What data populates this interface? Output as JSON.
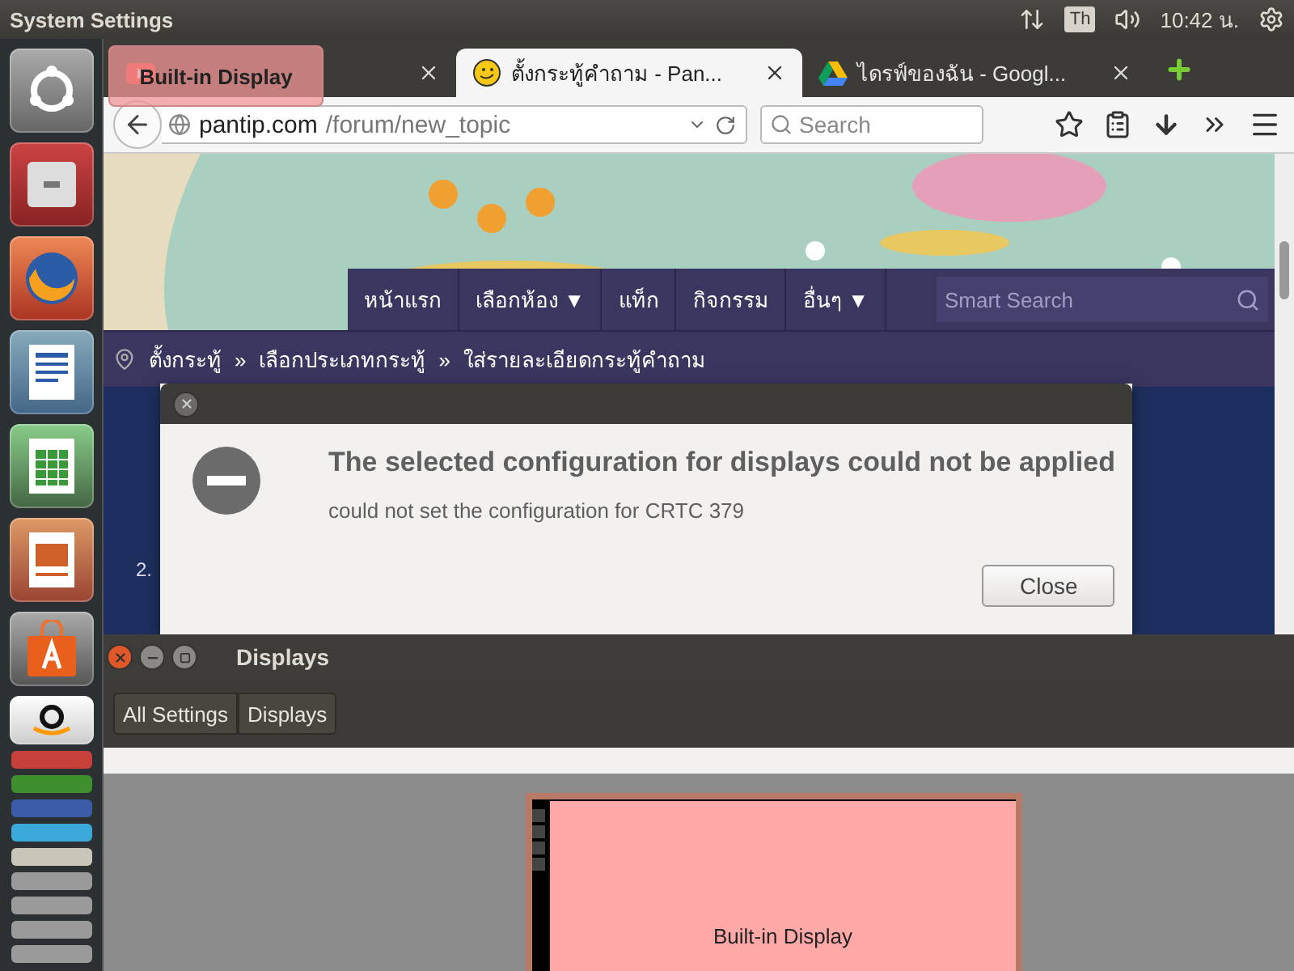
{
  "top_panel": {
    "title": "System Settings",
    "keyboard_layout": "Th",
    "clock": "10:42 น."
  },
  "launcher": {
    "items": [
      {
        "kind": "dash"
      },
      {
        "kind": "files"
      },
      {
        "kind": "firefox"
      },
      {
        "kind": "writer"
      },
      {
        "kind": "calc"
      },
      {
        "kind": "impress"
      },
      {
        "kind": "software"
      },
      {
        "kind": "amazon"
      },
      {
        "kind": "folded",
        "color": "#c8403a"
      },
      {
        "kind": "folded",
        "color": "#3f8f2f"
      },
      {
        "kind": "folded",
        "color": "#3b5da8"
      },
      {
        "kind": "folded",
        "color": "#3aa8d8"
      },
      {
        "kind": "folded",
        "color": "#c8c6b8"
      },
      {
        "kind": "folded",
        "color": "#9a9a9a"
      },
      {
        "kind": "folded",
        "color": "#9a9a9a"
      },
      {
        "kind": "folded",
        "color": "#9a9a9a"
      },
      {
        "kind": "folded",
        "color": "#9a9a9a"
      }
    ]
  },
  "browser": {
    "tabs": [
      {
        "kind": "video",
        "selected": false
      },
      {
        "kind": "emoji",
        "title": "ตั้งกระทู้คำถาม - Pan...",
        "selected": true
      },
      {
        "kind": "drive",
        "title": "ไดรฟ์ของฉัน - Googl...",
        "selected": false
      }
    ],
    "address": {
      "host": "pantip.com",
      "path": "/forum/new_topic"
    },
    "search": {
      "placeholder": "Search"
    },
    "page": {
      "nav": [
        "หน้าแรก",
        "เลือกห้อง ▼",
        "แท็ก",
        "กิจกรรม",
        "อื่นๆ ▼"
      ],
      "smart_search": {
        "placeholder": "Smart Search"
      },
      "breadcrumb": {
        "separator": "»",
        "items": [
          "ตั้งกระทู้",
          "เลือกประเภทกระทู้",
          "ใส่รายละเอียดกระทู้คำถาม"
        ]
      },
      "item_number": "2."
    }
  },
  "overlay_label": "Built-in Display",
  "dialog": {
    "heading": "The selected configuration for displays could not be applied",
    "message": "could not set the configuration for CRTC 379",
    "button": "Close"
  },
  "displays_window": {
    "title": "Displays",
    "breadcrumbs": [
      "All Settings",
      "Displays"
    ],
    "monitor": {
      "label": "Built-in Display"
    }
  }
}
